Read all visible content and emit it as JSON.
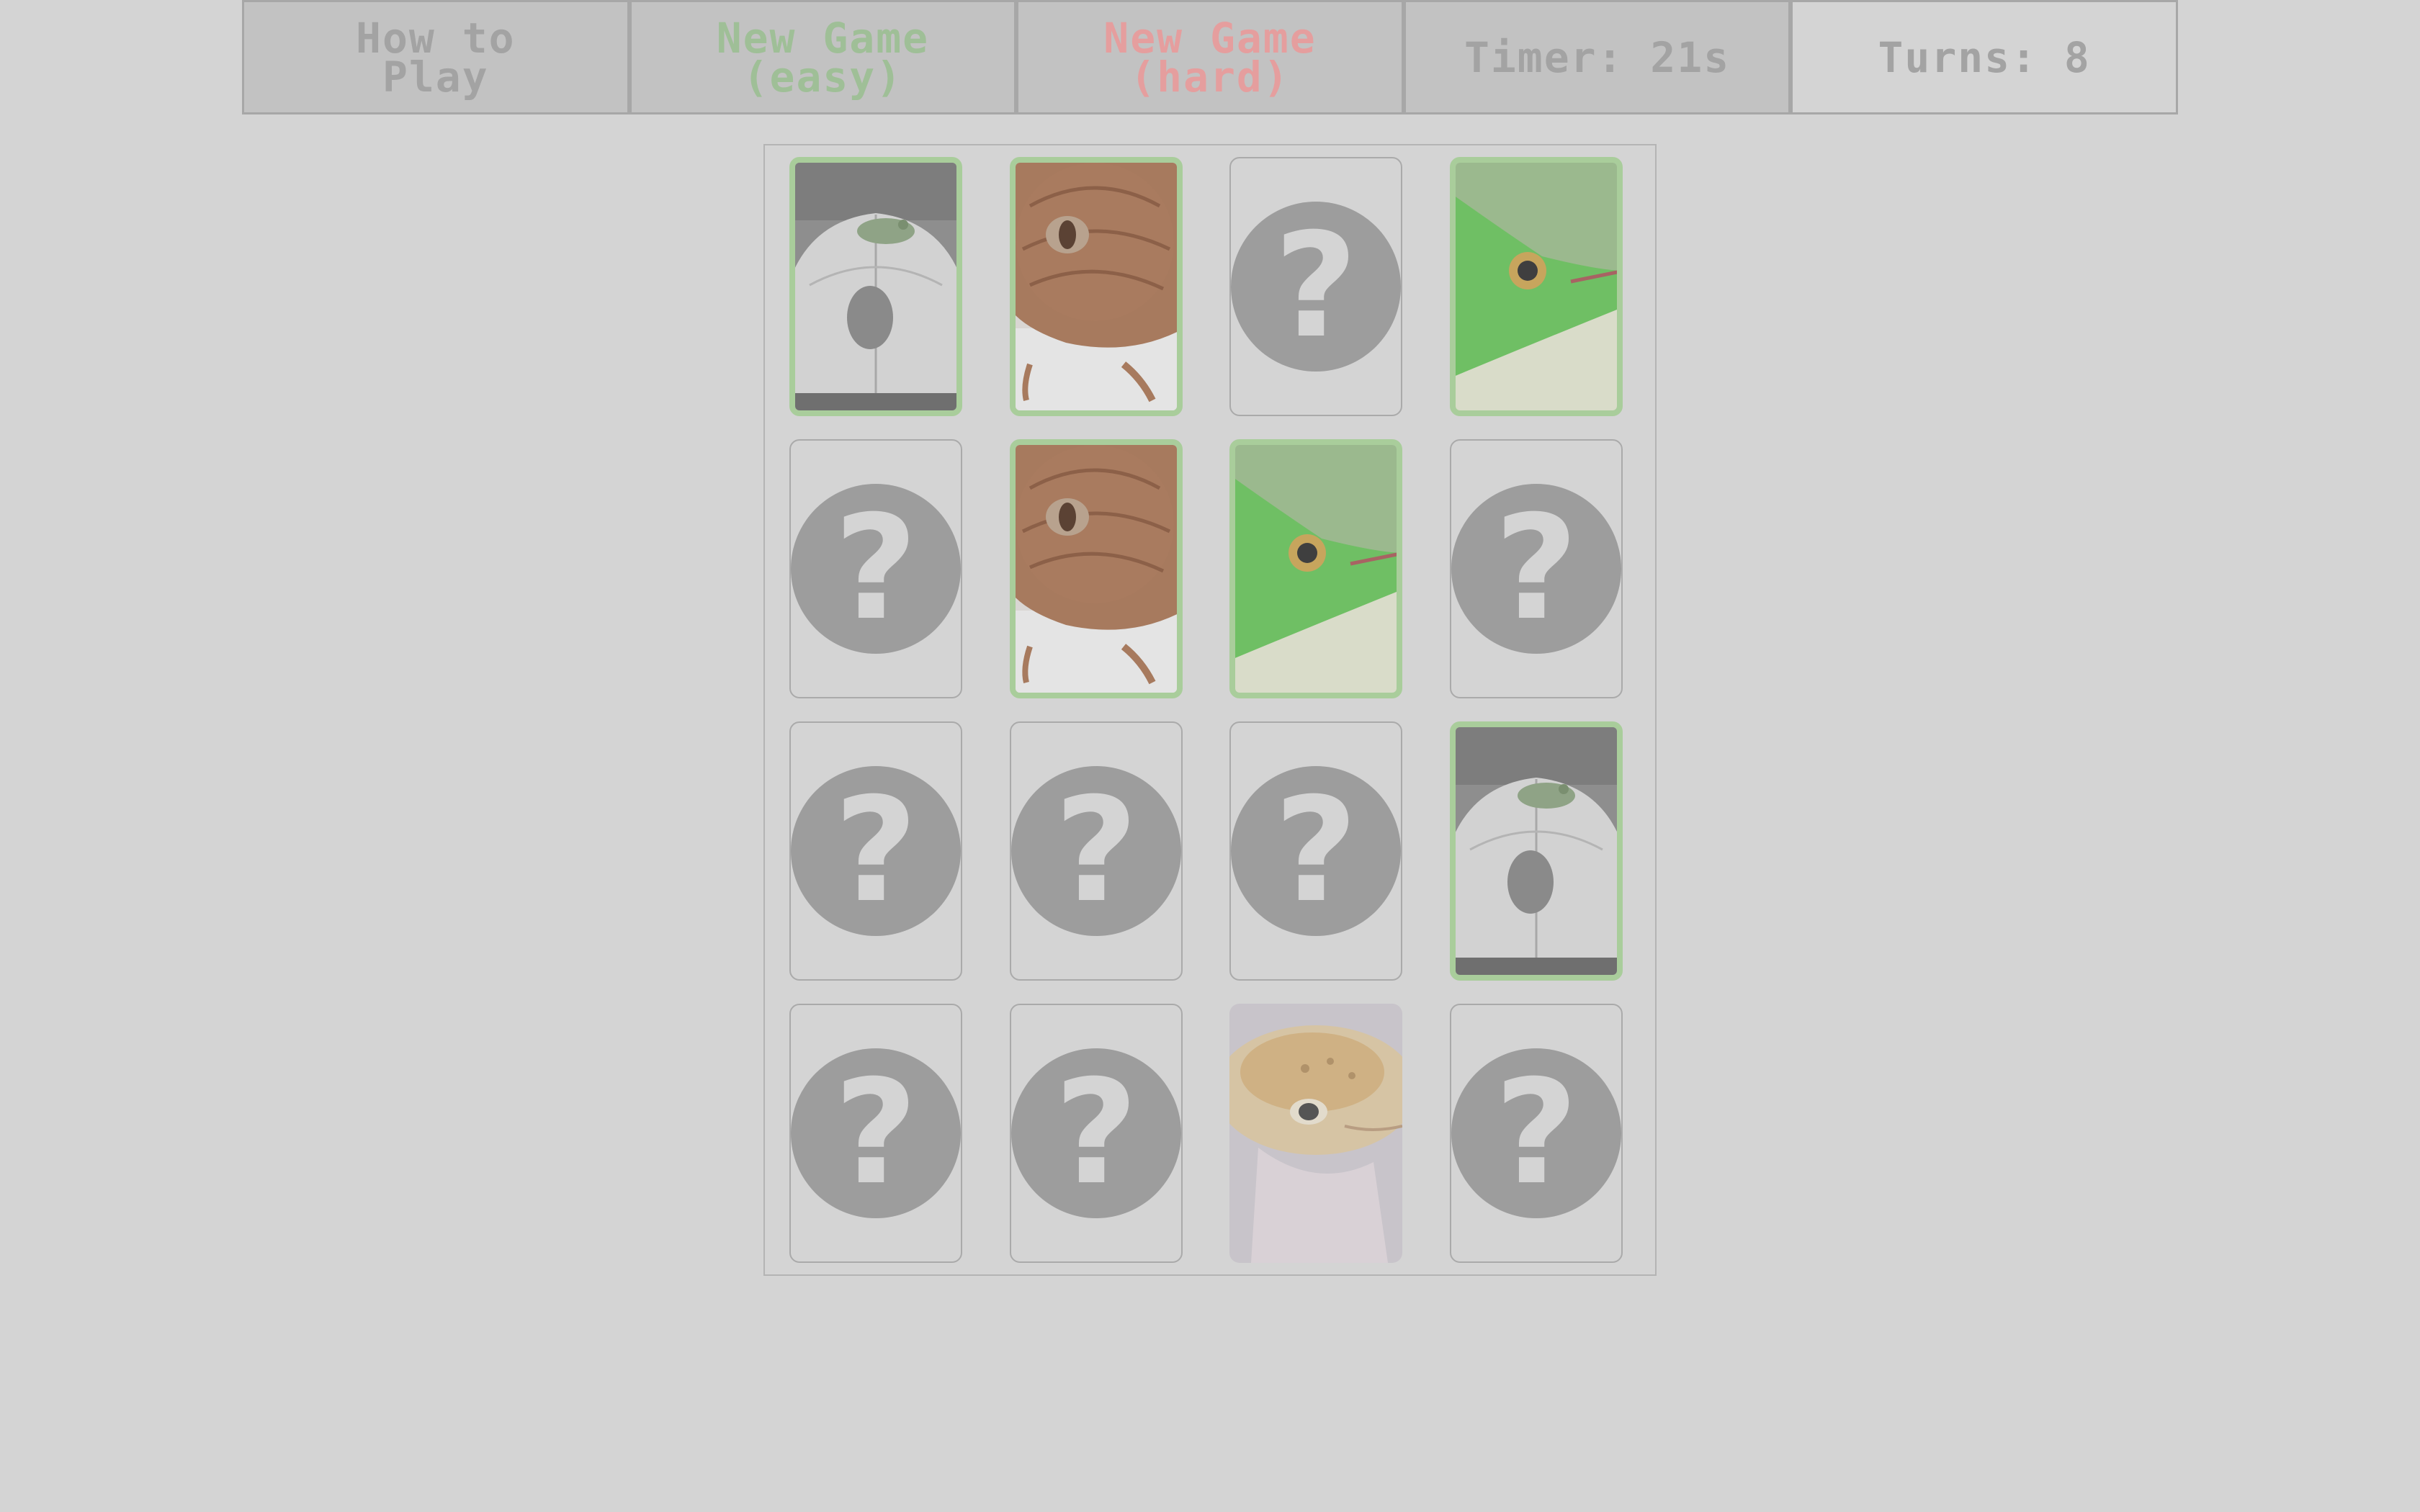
{
  "topbar": {
    "how_to_play": "How to\nPlay",
    "new_game_easy": "New Game\n(easy)",
    "new_game_hard": "New Game\n(hard)",
    "timer_label": "Timer: 21s",
    "turns_label": "Turns: 8"
  },
  "colors": {
    "background": "#d4d4d4",
    "easy_text": "#9fbf97",
    "hard_text": "#e59e9e",
    "neutral_text": "#a3a3a3",
    "matched_border": "#a9cd9b",
    "card_back_circle": "#9d9d9d"
  },
  "board": {
    "rows": 4,
    "cols": 4,
    "cards": [
      {
        "state": "matched",
        "image": "mouse-frog"
      },
      {
        "state": "matched",
        "image": "brown-gecko"
      },
      {
        "state": "hidden",
        "symbol": "?"
      },
      {
        "state": "matched",
        "image": "green-gecko"
      },
      {
        "state": "hidden",
        "symbol": "?"
      },
      {
        "state": "matched",
        "image": "brown-gecko"
      },
      {
        "state": "matched",
        "image": "green-gecko"
      },
      {
        "state": "hidden",
        "symbol": "?"
      },
      {
        "state": "hidden",
        "symbol": "?"
      },
      {
        "state": "hidden",
        "symbol": "?"
      },
      {
        "state": "hidden",
        "symbol": "?"
      },
      {
        "state": "matched",
        "image": "mouse-frog"
      },
      {
        "state": "hidden",
        "symbol": "?"
      },
      {
        "state": "hidden",
        "symbol": "?"
      },
      {
        "state": "flipped",
        "image": "leopard-gecko"
      },
      {
        "state": "hidden",
        "symbol": "?"
      }
    ]
  }
}
